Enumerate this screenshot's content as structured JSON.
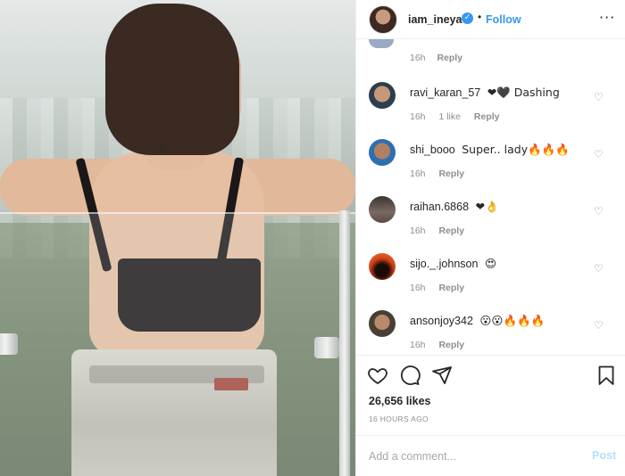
{
  "post": {
    "username": "iam_ineya",
    "verified_glyph": "✓",
    "separator": "•",
    "follow_label": "Follow",
    "more_glyph": "···"
  },
  "previous_comment": {
    "time": "16h",
    "reply_label": "Reply"
  },
  "comments": [
    {
      "username": "ravi_karan_57",
      "text": "❤🖤 Dashing",
      "time": "16h",
      "likes": "1 like",
      "reply_label": "Reply",
      "avatar_color": "#2c3e50"
    },
    {
      "username": "shi_booo",
      "text": "Super.. lady🔥🔥🔥",
      "time": "16h",
      "likes": "",
      "reply_label": "Reply",
      "avatar_color": "#2e6fb0"
    },
    {
      "username": "raihan.6868",
      "text": "❤👌",
      "time": "16h",
      "likes": "",
      "reply_label": "Reply",
      "avatar_color": "#5a4a44"
    },
    {
      "username": "sijo._.johnson",
      "text": "😍",
      "time": "16h",
      "likes": "",
      "reply_label": "Reply",
      "avatar_color": "#d2401c"
    },
    {
      "username": "ansonjoy342",
      "text": "😮😮🔥🔥🔥",
      "time": "16h",
      "likes": "",
      "reply_label": "Reply",
      "avatar_color": "#4a3f36"
    }
  ],
  "comment_like_glyph": "♡",
  "actions": {
    "like_icon": "heart-icon",
    "comment_icon": "comment-icon",
    "share_icon": "share-icon",
    "save_icon": "bookmark-icon"
  },
  "likes_text": "26,656 likes",
  "timestamp": "16 HOURS AGO",
  "add_comment": {
    "placeholder": "Add a comment...",
    "post_label": "Post"
  },
  "colors": {
    "accent": "#3897f0",
    "post_disabled": "#b2dffc",
    "muted": "#8e8e8e"
  }
}
